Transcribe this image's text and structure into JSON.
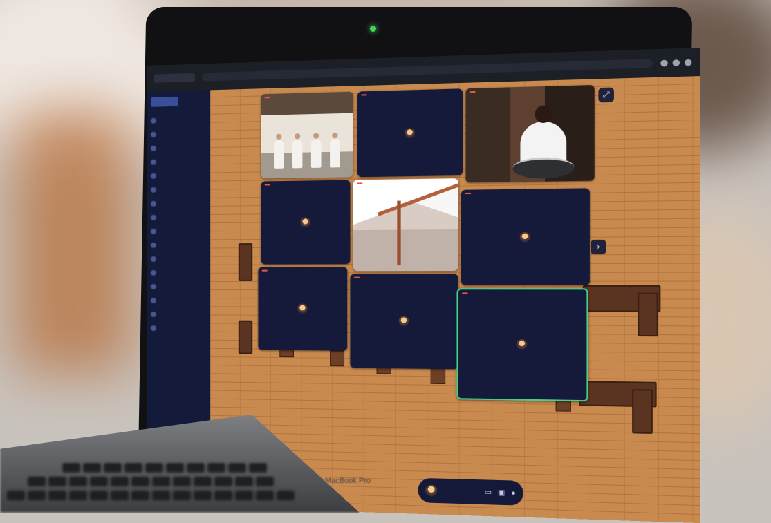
{
  "scene": {
    "brand_text": "MacBook Pro"
  },
  "browser": {
    "tab": "",
    "url": ""
  },
  "sidebar": {
    "items": [
      "",
      "",
      "",
      "",
      "",
      "",
      "",
      "",
      "",
      "",
      "",
      "",
      "",
      "",
      "",
      ""
    ]
  },
  "tiles": [
    {
      "tag": "",
      "kind": "video-kitchen"
    },
    {
      "tag": "",
      "kind": "avatar",
      "caption": ""
    },
    {
      "tag": "",
      "kind": "video-home"
    },
    {
      "tag": "",
      "kind": "avatar",
      "caption": ""
    },
    {
      "tag": "",
      "kind": "video-room"
    },
    {
      "tag": "",
      "kind": "avatar"
    },
    {
      "tag": "",
      "kind": "avatar"
    },
    {
      "tag": "",
      "kind": "avatar"
    },
    {
      "tag": "",
      "kind": "avatar",
      "active": true
    }
  ],
  "controls": {
    "self_name": "",
    "icons": [
      "screen-share-icon",
      "camera-icon",
      "mic-icon"
    ]
  },
  "icons": {
    "expand": "expand-icon",
    "next": "chevron-right-icon"
  },
  "colors": {
    "map_floor": "#c98a4f",
    "tile_bg": "#161a3a",
    "name_tag": "#e2584a",
    "active_border": "#45d08a",
    "sidebar_bg": "#141b3a"
  }
}
